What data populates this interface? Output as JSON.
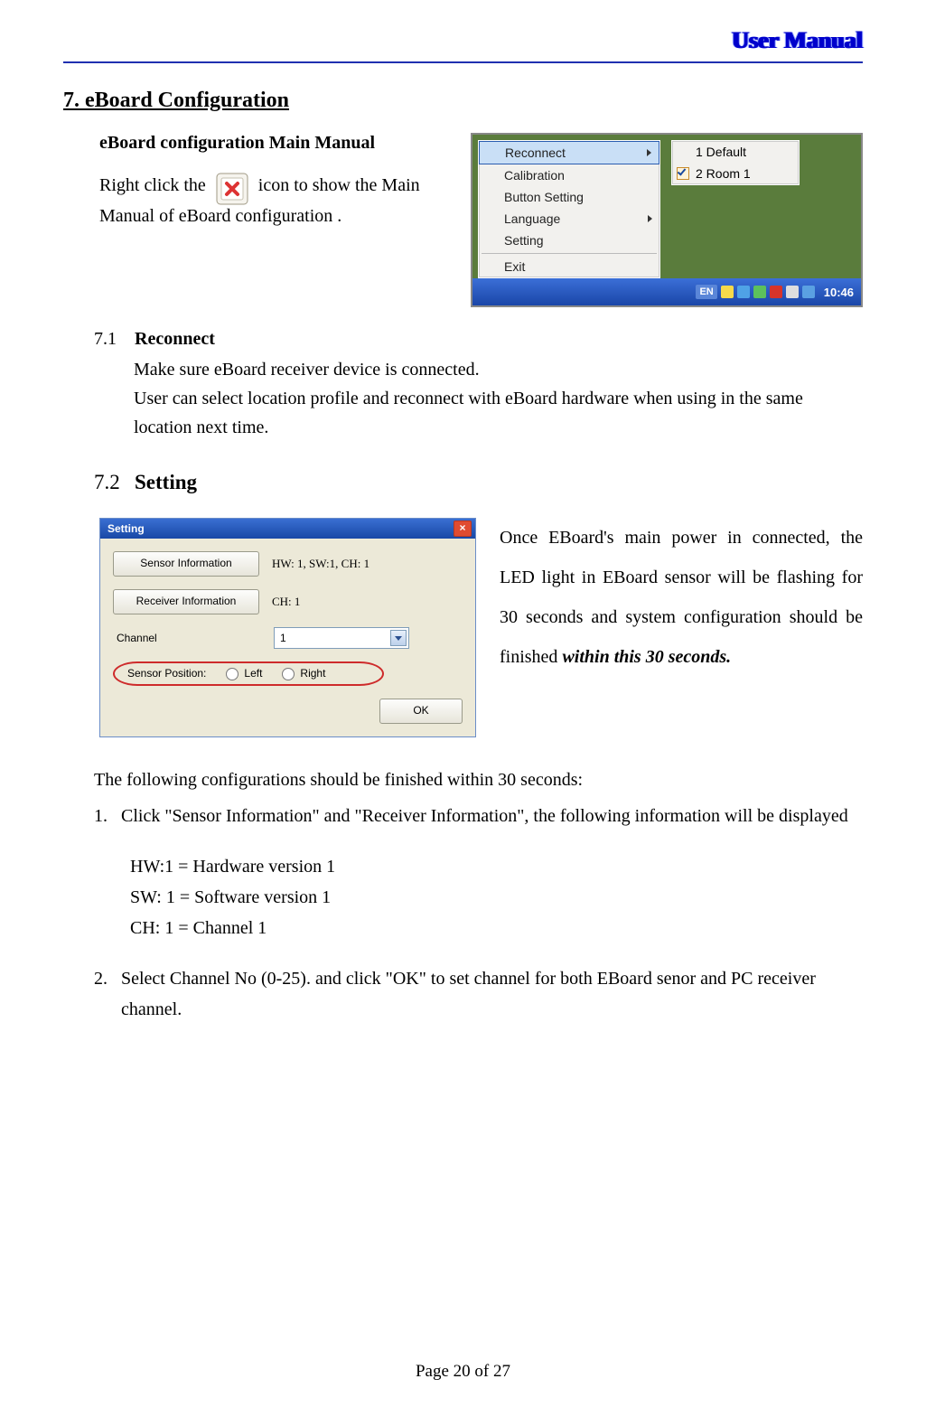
{
  "header": {
    "running_title": "User Manual"
  },
  "section": {
    "number_title": "7. eBoard Configuration",
    "intro_heading": "eBoard configuration Main Manual",
    "intro_text_a": "Right   click    the ",
    "intro_text_b": "   icon  to show the Main Manual of eBoard configuration ."
  },
  "menu_fig": {
    "left_items": [
      "Reconnect",
      "Calibration",
      "Button Setting",
      "Language",
      "Setting",
      "Exit"
    ],
    "left_has_arrow": [
      true,
      false,
      false,
      true,
      false,
      false
    ],
    "right_items": [
      "1 Default",
      "2 Room 1"
    ],
    "right_checked_index": 1,
    "taskbar": {
      "lang": "EN",
      "clock": "10:46"
    }
  },
  "s71": {
    "num": "7.1",
    "title": "Reconnect",
    "line1": "Make sure eBoard receiver device is connected.",
    "line2": "User can select location profile and reconnect with eBoard hardware when using in  the same location next time."
  },
  "s72": {
    "num": "7.2",
    "title": "Setting"
  },
  "setting_fig": {
    "title": "Setting",
    "btn_sensor": "Sensor Information",
    "val_sensor": "HW: 1, SW:1, CH: 1",
    "btn_receiver": "Receiver Information",
    "val_receiver": "CH: 1",
    "lbl_channel": "Channel",
    "channel_value": "1",
    "lbl_sensorpos": "Sensor Position:",
    "radio_left": "Left",
    "radio_right": "Right",
    "btn_ok": "OK"
  },
  "s72_para": {
    "a": "Once  EBoard's  main  power  in connected, the LED light in EBoard sensor  will  be  flashing  for  30 seconds  and  system  configuration should  be  finished ",
    "b": "within  this  30 seconds."
  },
  "following": {
    "lead": "The following configurations should be finished within 30 seconds:",
    "i1n": "1.",
    "i1": "Click \"Sensor Information\" and \"Receiver Information\", the following information will be displayed",
    "d1": "HW:1 = Hardware version 1",
    "d2": "SW: 1 = Software version 1",
    "d3": "CH: 1 = Channel 1",
    "i2n": "2.",
    "i2": "Select Channel No (0-25). and click \"OK\" to set channel for both EBoard senor and PC receiver channel."
  },
  "footer": {
    "page": "Page 20 of 27"
  }
}
